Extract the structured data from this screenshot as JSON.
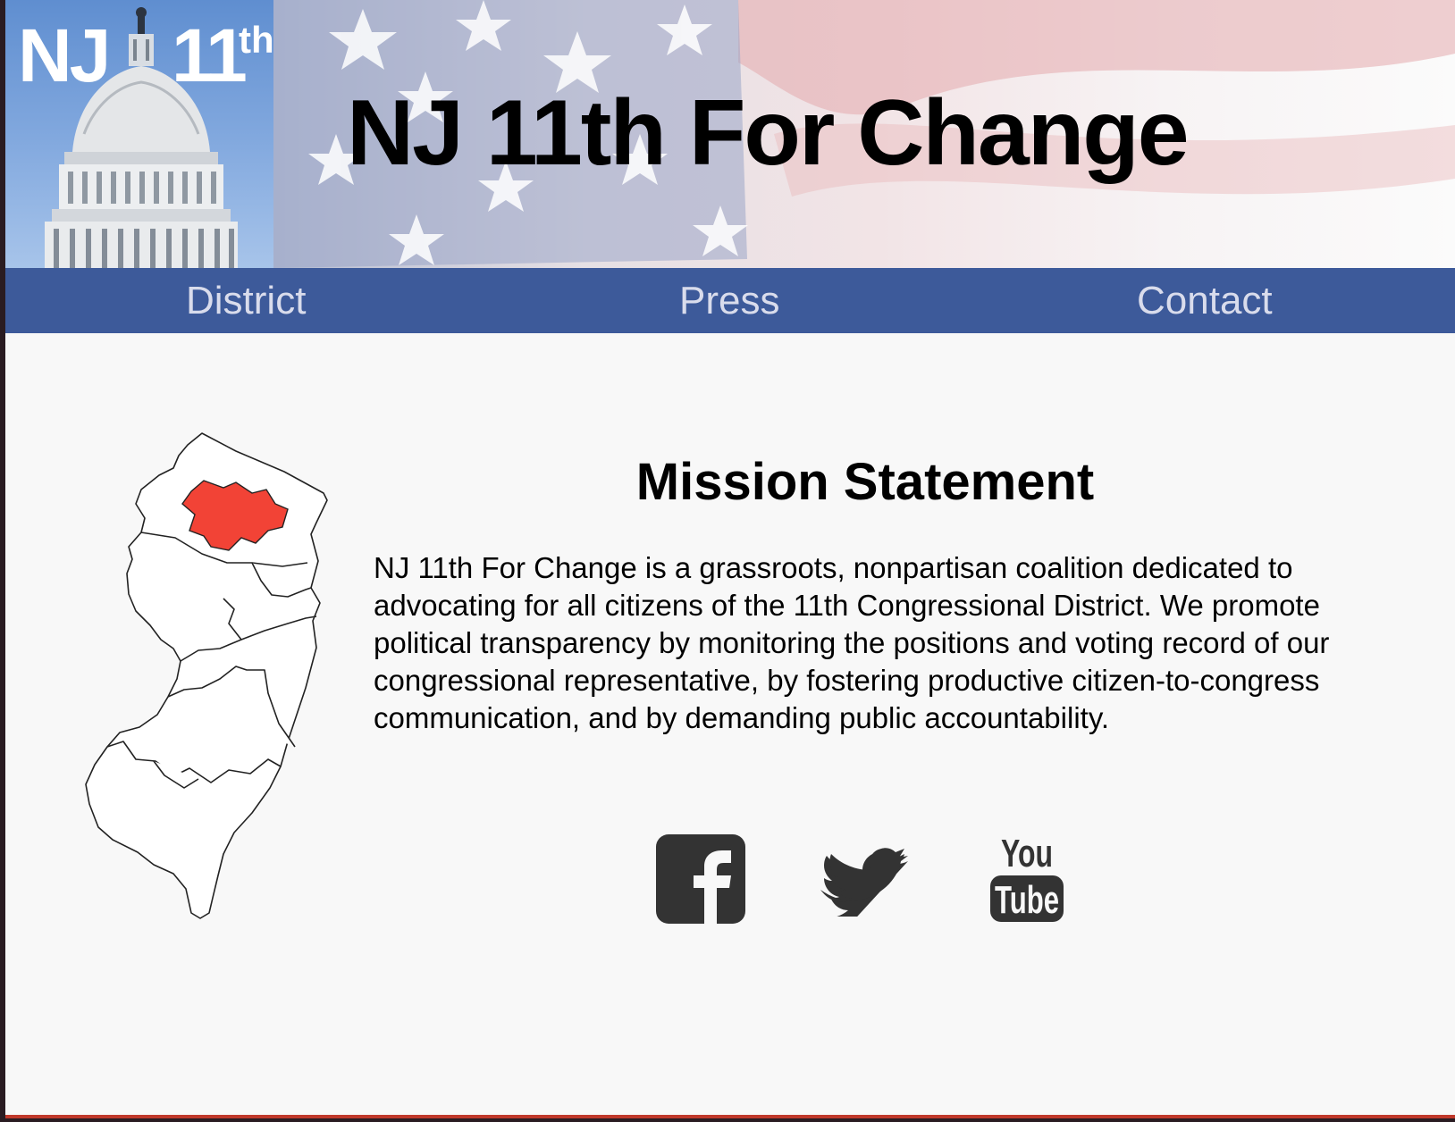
{
  "header": {
    "logo": {
      "nj": "NJ",
      "number": "11",
      "suffix": "th"
    },
    "title": "NJ 11th For Change"
  },
  "nav": {
    "items": [
      {
        "label": "District"
      },
      {
        "label": "Press"
      },
      {
        "label": "Contact"
      }
    ],
    "background": "#3d5a9a",
    "text_color": "#d9dcec"
  },
  "main": {
    "mission_title": "Mission Statement",
    "mission_text": "NJ 11th For Change is a grassroots, nonpartisan coalition dedicated to advocating for all citizens of the 11th Congressional District. We promote political transparency by monitoring the positions and voting record of our congressional representative, by fostering productive citizen-to-congress communication, and by demanding public accountability.",
    "map_highlight_color": "#f24336"
  },
  "social": {
    "facebook_icon": "facebook-icon",
    "twitter_icon": "twitter-icon",
    "youtube_icon": "youtube-icon",
    "youtube_you": "You",
    "youtube_tube": "Tube",
    "icon_color": "#333333"
  }
}
